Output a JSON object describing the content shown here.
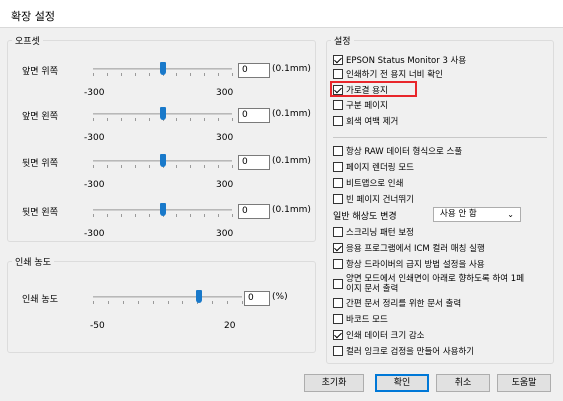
{
  "window": {
    "title": "확장 설정"
  },
  "offset": {
    "legend": "오프셋",
    "rows": [
      {
        "label": "앞면 위쪽",
        "value": "0",
        "unit": "(0.1mm)",
        "min": "-300",
        "max": "300",
        "level": 0.5
      },
      {
        "label": "앞면 왼쪽",
        "value": "0",
        "unit": "(0.1mm)",
        "min": "-300",
        "max": "300",
        "level": 0.5
      },
      {
        "label": "뒷면 위쪽",
        "value": "0",
        "unit": "(0.1mm)",
        "min": "-300",
        "max": "300",
        "level": 0.5
      },
      {
        "label": "뒷면 왼쪽",
        "value": "0",
        "unit": "(0.1mm)",
        "min": "-300",
        "max": "300",
        "level": 0.5
      }
    ]
  },
  "density": {
    "legend": "인쇄 농도",
    "label": "인쇄 농도",
    "value": "0",
    "unit": "(%)",
    "min": "-50",
    "max": "20",
    "level": 0.714
  },
  "settings": {
    "legend": "설정",
    "top_items": [
      {
        "label": "EPSON Status Monitor 3 사용",
        "checked": true
      },
      {
        "label": "인쇄하기 전 용지 너비 확인",
        "checked": false
      },
      {
        "label": "가로결 용지",
        "checked": true,
        "highlighted": true
      },
      {
        "label": "구분 페이지",
        "checked": false
      },
      {
        "label": "회색 여백 제거",
        "checked": false
      }
    ],
    "mid_items": [
      {
        "label": "항상 RAW 데이터 형식으로 스풀",
        "checked": false
      },
      {
        "label": "페이지 렌더링 모드",
        "checked": false
      },
      {
        "label": "비트맵으로 인쇄",
        "checked": false
      },
      {
        "label": "빈 페이지 건너뛰기",
        "checked": false
      }
    ],
    "resolution": {
      "label": "일반 해상도 변경",
      "value": "사용 안 함"
    },
    "bottom_items": [
      {
        "label": "스크리닝 패턴 보정",
        "checked": false
      },
      {
        "label": "응용 프로그램에서 ICM 컬러 매칭 실행",
        "checked": true
      },
      {
        "label": "항상 드라이버의 급지 방법 설정을 사용",
        "checked": false
      },
      {
        "label_line1": "양면 모드에서 인쇄면이 아래로 향하도록 하여 1페",
        "label_line2": "이지 문서 출력",
        "checked": false
      },
      {
        "label": "간편 문서 정리를 위한 문서 출력",
        "checked": false
      },
      {
        "label": "바코드 모드",
        "checked": false
      },
      {
        "label": "인쇄 데이터 크기 감소",
        "checked": true
      },
      {
        "label": "컬러 잉크로 검정을 만들어 사용하기",
        "checked": false
      }
    ]
  },
  "buttons": {
    "reset": "초기화",
    "ok": "확인",
    "cancel": "취소",
    "help": "도움말"
  },
  "icons": {
    "dropdown": "chevron-down-icon",
    "checkbox": "checkmark-icon"
  }
}
